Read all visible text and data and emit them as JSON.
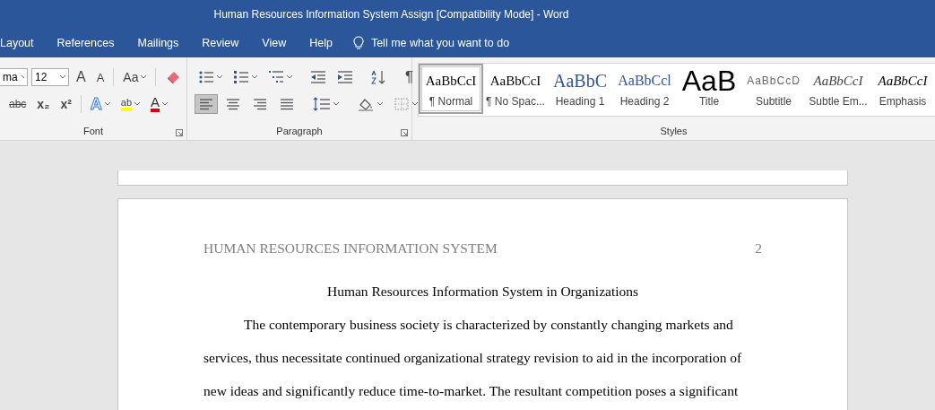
{
  "title_bar": {
    "title": "Human Resources Information System Assign [Compatibility Mode]  -  Word"
  },
  "tabs": [
    {
      "label": "Layout"
    },
    {
      "label": "References"
    },
    {
      "label": "Mailings"
    },
    {
      "label": "Review"
    },
    {
      "label": "View"
    },
    {
      "label": "Help"
    }
  ],
  "tell_me": {
    "placeholder": "Tell me what you want to do"
  },
  "font_group": {
    "label": "Font",
    "font_name": "ma",
    "font_size": "12",
    "row1": [
      {
        "kind": "grow",
        "glyph": "A"
      },
      {
        "kind": "shrink",
        "glyph": "A"
      },
      {
        "kind": "case",
        "glyph": "Aa"
      },
      {
        "kind": "clear"
      }
    ],
    "row2": [
      {
        "kind": "strike",
        "glyph": "abc"
      },
      {
        "kind": "sub",
        "glyph": "x₂"
      },
      {
        "kind": "sup",
        "glyph": "x²"
      },
      {
        "kind": "effects",
        "glyph": "A"
      },
      {
        "kind": "highlight",
        "glyph": "ab",
        "color": "#ffff00"
      },
      {
        "kind": "fontcolor",
        "glyph": "A",
        "color": "#e00000"
      }
    ]
  },
  "paragraph_group": {
    "label": "Paragraph",
    "row1": [
      {
        "kind": "bullets"
      },
      {
        "kind": "numbering"
      },
      {
        "kind": "multilevel"
      },
      {
        "kind": "outdent"
      },
      {
        "kind": "indent"
      },
      {
        "kind": "sort"
      },
      {
        "kind": "pilcrow",
        "glyph": "¶"
      }
    ],
    "alignment": [
      {
        "kind": "left",
        "selected": true
      },
      {
        "kind": "center",
        "selected": false
      },
      {
        "kind": "right",
        "selected": false
      },
      {
        "kind": "justify",
        "selected": false
      }
    ],
    "row2": [
      {
        "kind": "spacing"
      },
      {
        "kind": "shading"
      },
      {
        "kind": "borders"
      }
    ]
  },
  "styles_group": {
    "label": "Styles",
    "items": [
      {
        "sample": "AaBbCcI",
        "name": "¶ Normal",
        "kind": "normal",
        "selected": true
      },
      {
        "sample": "AaBbCcI",
        "name": "¶ No Spac...",
        "kind": "normal",
        "selected": false
      },
      {
        "sample": "AaBbC",
        "name": "Heading 1",
        "kind": "heading1",
        "selected": false
      },
      {
        "sample": "AaBbCcl",
        "name": "Heading 2",
        "kind": "heading2",
        "selected": false
      },
      {
        "sample": "AaB",
        "name": "Title",
        "kind": "title",
        "selected": false
      },
      {
        "sample": "AaBbCcD",
        "name": "Subtitle",
        "kind": "subtitle",
        "selected": false
      },
      {
        "sample": "AaBbCcI",
        "name": "Subtle Em...",
        "kind": "subtle",
        "selected": false
      },
      {
        "sample": "AaBbCcI",
        "name": "Emphasis",
        "kind": "emphasis",
        "selected": false
      }
    ]
  },
  "document": {
    "header": "HUMAN RESOURCES INFORMATION SYSTEM",
    "page_number": "2",
    "heading": "Human Resources Information System in Organizations",
    "lines": [
      {
        "text": "The contemporary business society is characterized by constantly changing markets and",
        "indent": true
      },
      {
        "text": "services, thus necessitate continued organizational strategy revision to aid in the incorporation of",
        "indent": false
      },
      {
        "text": "new ideas and significantly reduce time-to-market. The resultant competition poses a significant",
        "indent": false
      }
    ]
  }
}
